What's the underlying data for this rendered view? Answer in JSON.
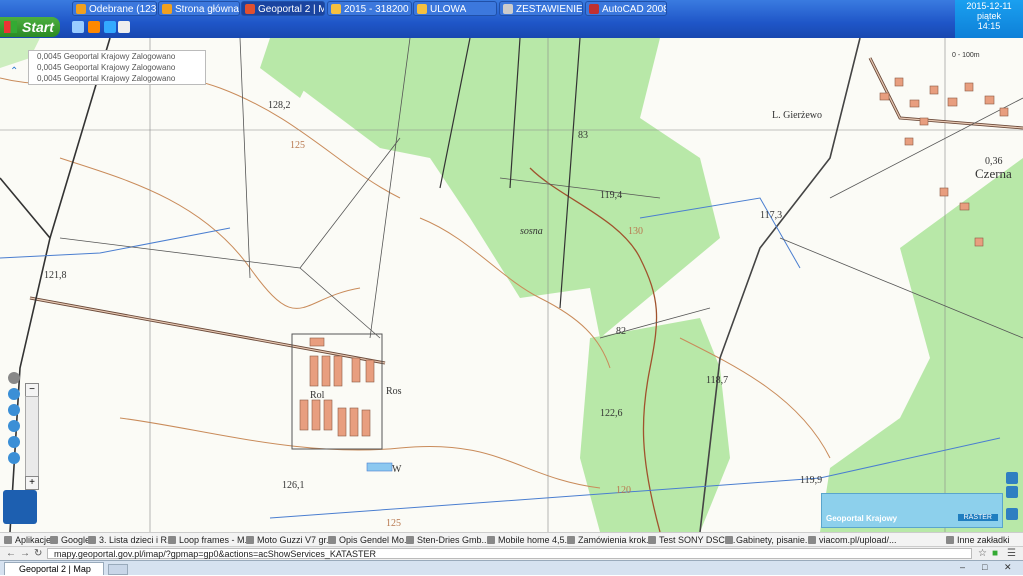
{
  "taskbar": {
    "start_label": "Start",
    "windows": [
      {
        "label": "Odebrane (123...",
        "color": "#f0a020"
      },
      {
        "label": "Strona główna - ...",
        "color": "#f0a020"
      },
      {
        "label": "Geoportal 2 | M...",
        "color": "#e05030",
        "active": true
      },
      {
        "label": "2015 - 318200",
        "color": "#f5c040"
      },
      {
        "label": "ULOWA",
        "color": "#f5c040"
      },
      {
        "label": "ZESTAWIENIE 2...",
        "color": "#cccccc"
      },
      {
        "label": "AutoCAD 2008",
        "color": "#c03030"
      }
    ],
    "tray": {
      "date": "2015-12-11",
      "day": "piątek",
      "time": "14:15"
    }
  },
  "map": {
    "legend": [
      {
        "label": "0,0045 Geoportal Krajowy Zalogowano"
      },
      {
        "label": "0,0045 Geoportal Krajowy Zalogowano"
      },
      {
        "label": "0,0045 Geoportal Krajowy Zalogowano"
      }
    ],
    "labels": {
      "height_1": "128,2",
      "height_2": "121,8",
      "height_3": "119,4",
      "height_4": "117,3",
      "height_5": "118,7",
      "height_6": "122,6",
      "height_7": "126,1",
      "height_8": "119,9",
      "contour_1": "125",
      "contour_2": "130",
      "contour_3": "120",
      "contour_4": "125",
      "forest_1": "83",
      "forest_2": "82",
      "place_1": "Czerna",
      "place_2": "L. Gierżewo",
      "place_3": "0,36",
      "place_4": "sosna",
      "place_5": "Ros",
      "place_6": "Rol",
      "place_7": "W"
    },
    "scale": "0 - 100m",
    "overview": {
      "label": "Geoportal Krajowy",
      "button": "RASTER"
    }
  },
  "bookmarks": [
    {
      "label": "Aplikacje"
    },
    {
      "label": "Google"
    },
    {
      "label": "3. Lista dzieci i R..."
    },
    {
      "label": "Loop frames - M..."
    },
    {
      "label": "Moto Guzzi V7 gr..."
    },
    {
      "label": "Opis Gendel Mo..."
    },
    {
      "label": "Sten-Dries Gmb..."
    },
    {
      "label": "Mobile home 4,5..."
    },
    {
      "label": "Zamówienia krok..."
    },
    {
      "label": "Test SONY DSC-..."
    },
    {
      "label": "Gabinety, pisanie..."
    },
    {
      "label": "viacom.pl/upload/..."
    },
    {
      "label": "Inne zakładki"
    }
  ],
  "address": {
    "url": "mapy.geoportal.gov.pl/imap/?gpmap=gp0&actions=acShowServices_KATASTER"
  },
  "tab": {
    "label": "Geoportal 2 | Map"
  }
}
